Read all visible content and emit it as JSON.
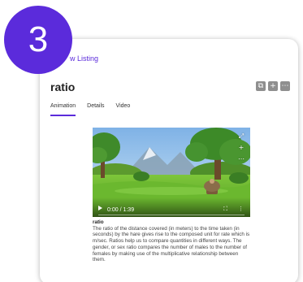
{
  "step_badge": "3",
  "back_link": "w Listing",
  "listing": {
    "title": "ratio",
    "actions": [
      {
        "name": "copy",
        "glyph": "⧉"
      },
      {
        "name": "add",
        "glyph": "+"
      },
      {
        "name": "more",
        "glyph": "⋯"
      }
    ]
  },
  "tabs": [
    {
      "label": "Animation",
      "active": true
    },
    {
      "label": "Details",
      "active": false
    },
    {
      "label": "Video",
      "active": false
    }
  ],
  "video": {
    "time": "0:00 / 1:39",
    "progress": 0
  },
  "description": {
    "heading": "ratio",
    "body": "The ratio of the distance covered (in meters) to the time taken (in seconds) by the hare gives rise to the composed unit for rate which is m/sec. Ratios help us to compare quantities in different ways. The gender, or sex ratio compares the number of males to the number of females by making use of the multiplicative relationship between them."
  },
  "colors": {
    "accent": "#5b2bdb"
  }
}
